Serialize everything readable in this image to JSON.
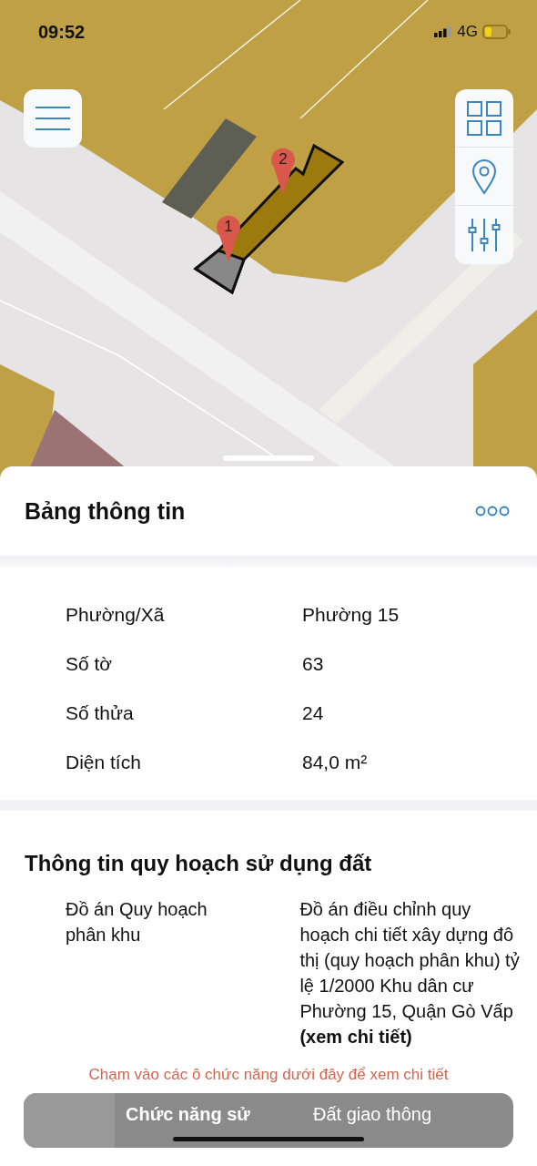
{
  "status_bar": {
    "time": "09:52",
    "network": "4G"
  },
  "map": {
    "kind": "picture",
    "pins": [
      {
        "label": "1"
      },
      {
        "label": "2"
      }
    ]
  },
  "sheet": {
    "title": "Bảng thông tin",
    "rows": [
      {
        "label": "Phường/Xã",
        "value": "Phường 15"
      },
      {
        "label": "Số tờ",
        "value": "63"
      },
      {
        "label": "Số thửa",
        "value": "24"
      },
      {
        "label": "Diện tích",
        "value": "84,0 m²"
      }
    ]
  },
  "planning": {
    "title": "Thông tin quy hoạch sử dụng đất",
    "rows": [
      {
        "label": "Đồ án Quy hoạch phân khu",
        "value": "Đồ án điều chỉnh quy hoạch chi tiết xây dựng đô thị (quy hoạch phân khu) tỷ lệ 1/2000 Khu dân cư Phường 15, Quận Gò Vấp",
        "link": "(xem chi tiết)"
      }
    ],
    "hint": "Chạm vào các ô chức năng dưới đây để xem chi tiết",
    "function_card": {
      "label": "Chức năng sử",
      "value": "Đất giao thông"
    }
  }
}
